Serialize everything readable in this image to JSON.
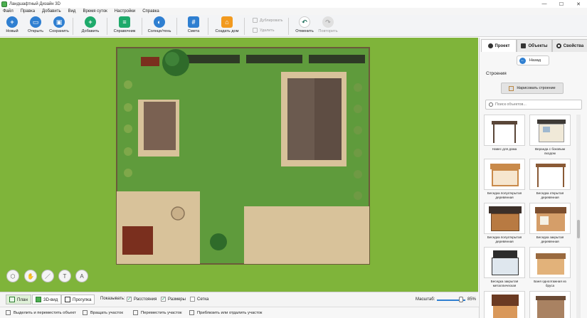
{
  "window": {
    "title": "Ландшафтный Дизайн 3D",
    "controls": {
      "minimize": "—",
      "maximize": "☐",
      "close": "✕"
    }
  },
  "menu": [
    "Файл",
    "Правка",
    "Добавить",
    "Вид",
    "Время суток",
    "Настройки",
    "Справка"
  ],
  "toolbar": {
    "new": "Новый",
    "open": "Открыть",
    "save": "Сохранить",
    "add": "Добавить",
    "reference": "Справочник",
    "sun_shadow": "Солнце/тень",
    "estimate": "Смета",
    "create_house": "Создать дом",
    "duplicate": "Дублировать",
    "delete": "Удалить",
    "undo": "Отменить",
    "redo": "Повторить"
  },
  "icons": {
    "new": "new-icon",
    "open": "folder-icon",
    "save": "save-icon",
    "add": "plus-icon",
    "reference": "book-icon",
    "sun_shadow": "sun-icon",
    "estimate": "calculator-icon",
    "create_house": "house-icon",
    "undo": "undo-icon",
    "redo": "redo-icon"
  },
  "colors": {
    "accent": "#2f7fd1",
    "grass_outer": "#7fb43a",
    "lawn": "#5f9b3c",
    "path": "#d8c29a",
    "roof": "#6b5a4f",
    "house_orange": "#f29a1f"
  },
  "panel": {
    "tabs": [
      "Проект",
      "Объекты",
      "Свойства"
    ],
    "back_label": "Назад",
    "section_title": "Строения",
    "draw_button": "Нарисовать строение",
    "search_placeholder": "Поиск объектов..."
  },
  "catalog": [
    {
      "caption": "Навес для дома"
    },
    {
      "caption": "Веранда с боковым входом"
    },
    {
      "caption": "Беседка полуоткрытая деревянная"
    },
    {
      "caption": "Беседка открытая деревянная"
    },
    {
      "caption": "Беседка полуоткрытая деревянная"
    },
    {
      "caption": "Беседка закрытая деревянная"
    },
    {
      "caption": "Беседка закрытая металлическая"
    },
    {
      "caption": "Баня одноэтажная из бруса"
    },
    {
      "caption": ""
    },
    {
      "caption": ""
    }
  ],
  "bottom": {
    "plan": "План",
    "view3d": "3D-вид",
    "walk": "Прогулка",
    "show_label": "Показывать:",
    "distances": "Расстояния",
    "distances_checked": true,
    "sizes": "Размеры",
    "sizes_checked": true,
    "grid": "Сетка",
    "grid_checked": false,
    "zoom_label": "Масштаб:",
    "zoom_value": "85%",
    "zoom_fraction": 0.85
  },
  "status": [
    "Выделить и переместить объект",
    "Вращать участок",
    "Переместить участок",
    "Приблизить или отдалить участок"
  ]
}
